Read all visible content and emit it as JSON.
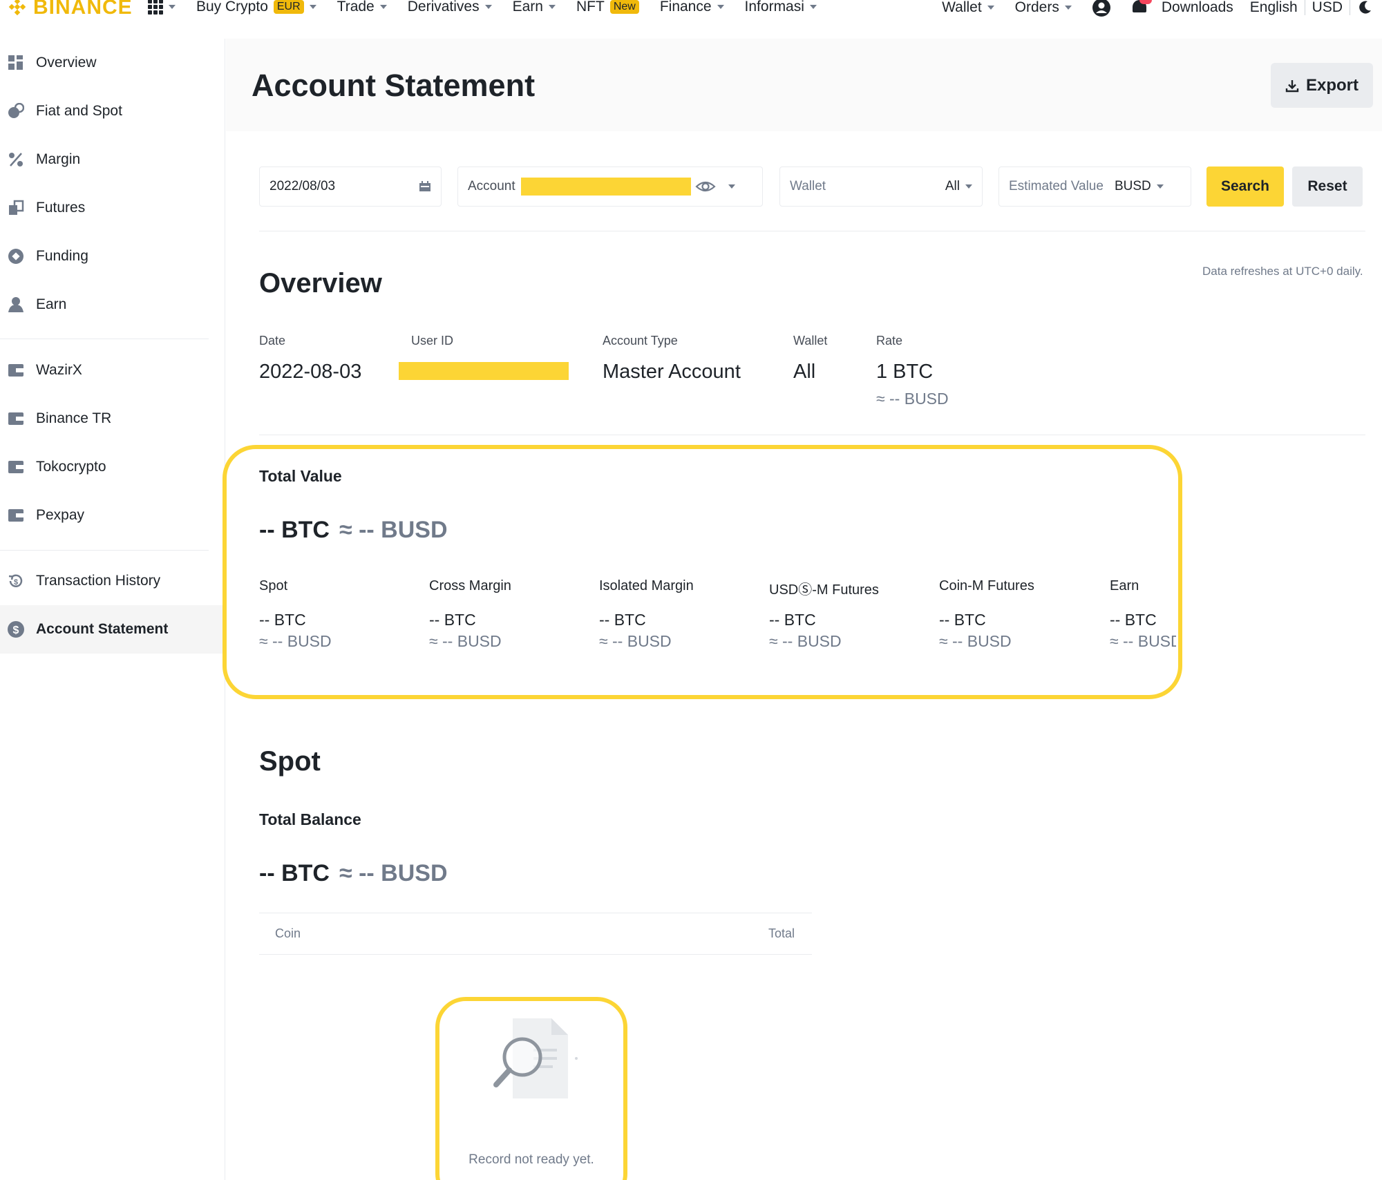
{
  "brand": {
    "name": "BINANCE",
    "color": "#f0b90b"
  },
  "colors": {
    "accent": "#fcd535",
    "text": "#1e2329",
    "muted": "#707a8a"
  },
  "topnav": {
    "left": [
      {
        "label": "Buy Crypto",
        "tag": "EUR"
      },
      {
        "label": "Trade"
      },
      {
        "label": "Derivatives"
      },
      {
        "label": "Earn"
      },
      {
        "label": "NFT",
        "tag": "New"
      },
      {
        "label": "Finance"
      },
      {
        "label": "Informasi"
      }
    ],
    "right": {
      "wallet": "Wallet",
      "orders": "Orders",
      "downloads": "Downloads",
      "language": "English",
      "currency": "USD"
    }
  },
  "sidebar": {
    "items": [
      {
        "label": "Overview",
        "icon": "overview-icon"
      },
      {
        "label": "Fiat and Spot",
        "icon": "fiat-spot-icon"
      },
      {
        "label": "Margin",
        "icon": "margin-icon"
      },
      {
        "label": "Futures",
        "icon": "futures-icon"
      },
      {
        "label": "Funding",
        "icon": "funding-icon"
      },
      {
        "label": "Earn",
        "icon": "earn-icon"
      },
      {
        "label": "WazirX",
        "icon": "wallet-icon"
      },
      {
        "label": "Binance TR",
        "icon": "wallet-icon"
      },
      {
        "label": "Tokocrypto",
        "icon": "wallet-icon"
      },
      {
        "label": "Pexpay",
        "icon": "wallet-icon"
      },
      {
        "label": "Transaction History",
        "icon": "history-icon"
      },
      {
        "label": "Account Statement",
        "icon": "statement-icon",
        "active": true
      }
    ]
  },
  "page": {
    "title": "Account Statement",
    "export_label": "Export"
  },
  "filters": {
    "date": "2022/08/03",
    "account_label": "Account",
    "wallet_label": "Wallet",
    "wallet_value": "All",
    "estimated_label": "Estimated Value",
    "estimated_value": "BUSD",
    "search_label": "Search",
    "reset_label": "Reset"
  },
  "overview": {
    "title": "Overview",
    "note": "Data refreshes at UTC+0 daily.",
    "date_label": "Date",
    "date_value": "2022-08-03",
    "userid_label": "User ID",
    "account_type_label": "Account Type",
    "account_type_value": "Master Account",
    "wallet_label": "Wallet",
    "wallet_value": "All",
    "rate_label": "Rate",
    "rate_value": "1 BTC",
    "rate_sub": "≈ -- BUSD"
  },
  "total_value": {
    "label": "Total Value",
    "btc": "-- BTC",
    "busd": "≈ -- BUSD",
    "accounts": [
      {
        "label": "Spot",
        "btc": "-- BTC",
        "busd": "≈ -- BUSD"
      },
      {
        "label": "Cross Margin",
        "btc": "-- BTC",
        "busd": "≈ -- BUSD"
      },
      {
        "label": "Isolated Margin",
        "btc": "-- BTC",
        "busd": "≈ -- BUSD"
      },
      {
        "label": "USDⓈ-M Futures",
        "btc": "-- BTC",
        "busd": "≈ -- BUSD"
      },
      {
        "label": "Coin-M Futures",
        "btc": "-- BTC",
        "busd": "≈ -- BUSD"
      },
      {
        "label": "Earn",
        "btc": "-- BTC",
        "busd": "≈ -- BUSD"
      }
    ]
  },
  "spot": {
    "title": "Spot",
    "balance_label": "Total Balance",
    "btc": "-- BTC",
    "busd": "≈ -- BUSD",
    "col_coin": "Coin",
    "col_total": "Total",
    "empty_text": "Record not ready yet."
  }
}
